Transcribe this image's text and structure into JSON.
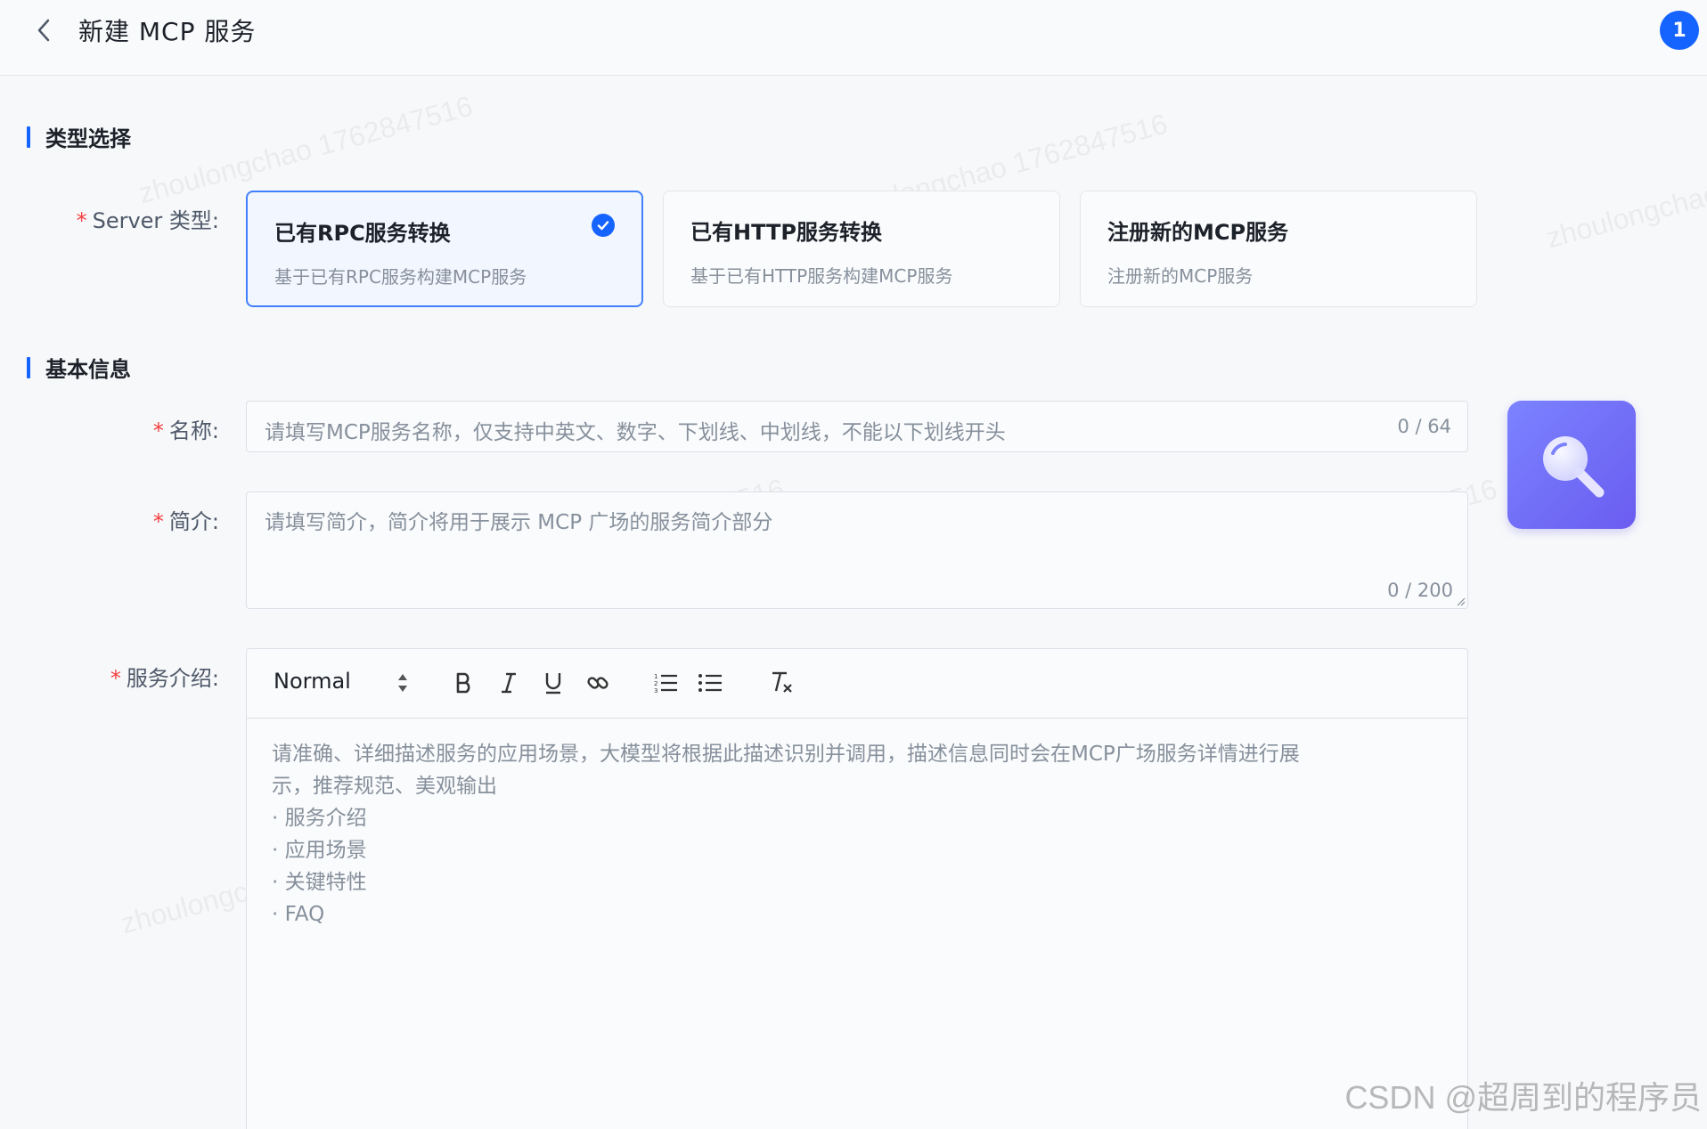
{
  "header": {
    "title": "新建 MCP 服务",
    "badge": "1"
  },
  "sections": {
    "type_select": "类型选择",
    "basic_info": "基本信息"
  },
  "labels": {
    "server_type": "Server 类型:",
    "name": "名称:",
    "intro": "简介:",
    "service_desc": "服务介绍:",
    "required_mark": "*"
  },
  "cards": [
    {
      "title": "已有RPC服务转换",
      "desc": "基于已有RPC服务构建MCP服务",
      "selected": true
    },
    {
      "title": "已有HTTP服务转换",
      "desc": "基于已有HTTP服务构建MCP服务",
      "selected": false
    },
    {
      "title": "注册新的MCP服务",
      "desc": "注册新的MCP服务",
      "selected": false
    }
  ],
  "name_input": {
    "placeholder": "请填写MCP服务名称，仅支持中英文、数字、下划线、中划线，不能以下划线开头",
    "count": "0 / 64"
  },
  "intro_input": {
    "placeholder": "请填写简介，简介将用于展示 MCP 广场的服务简介部分",
    "count": "0 / 200"
  },
  "editor": {
    "format_select": "Normal",
    "placeholder_lines": [
      "请准确、详细描述服务的应用场景，大模型将根据此描述识别并调用，描述信息同时会在MCP广场服务详情进行展",
      "示，推荐规范、美观输出",
      "· 服务介绍",
      "· 应用场景",
      "· 关键特性",
      "· FAQ"
    ]
  },
  "watermark_text": "zhoulongchao 1762847516",
  "footer_credit": "CSDN @超周到的程序员",
  "colors": {
    "accent": "#1664ff",
    "required": "#f53f3f",
    "ai_button": "#7378f7"
  }
}
